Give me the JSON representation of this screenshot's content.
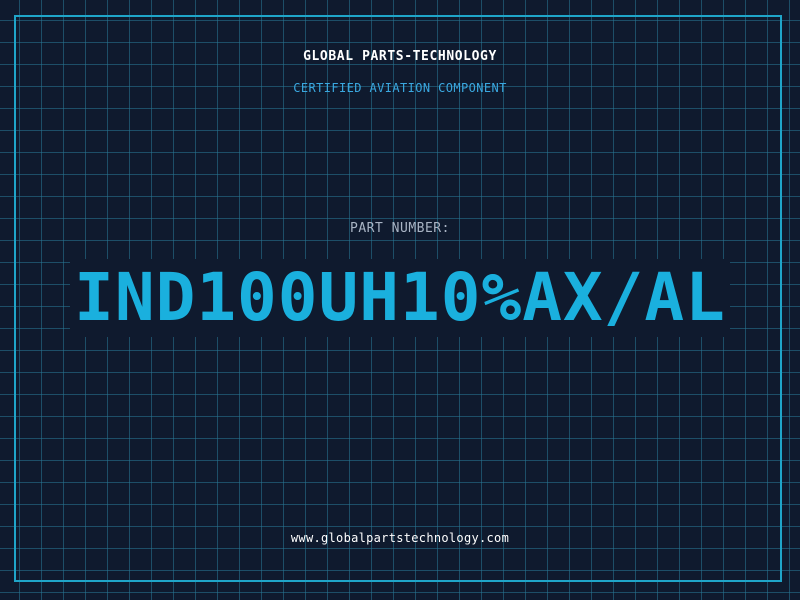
{
  "header": {
    "brand": "GLOBAL PARTS-TECHNOLOGY",
    "tagline": "CERTIFIED AVIATION COMPONENT"
  },
  "part": {
    "label": "PART NUMBER:",
    "number": "IND100UH10%AX/AL"
  },
  "footer": {
    "website": "www.globalpartstechnology.com"
  },
  "colors": {
    "background": "#0f1a2e",
    "grid": "#287896",
    "frame": "#1fa5c9",
    "accent": "#1ab0de",
    "tagline": "#3aa8e0",
    "label": "#a9b4c4"
  }
}
